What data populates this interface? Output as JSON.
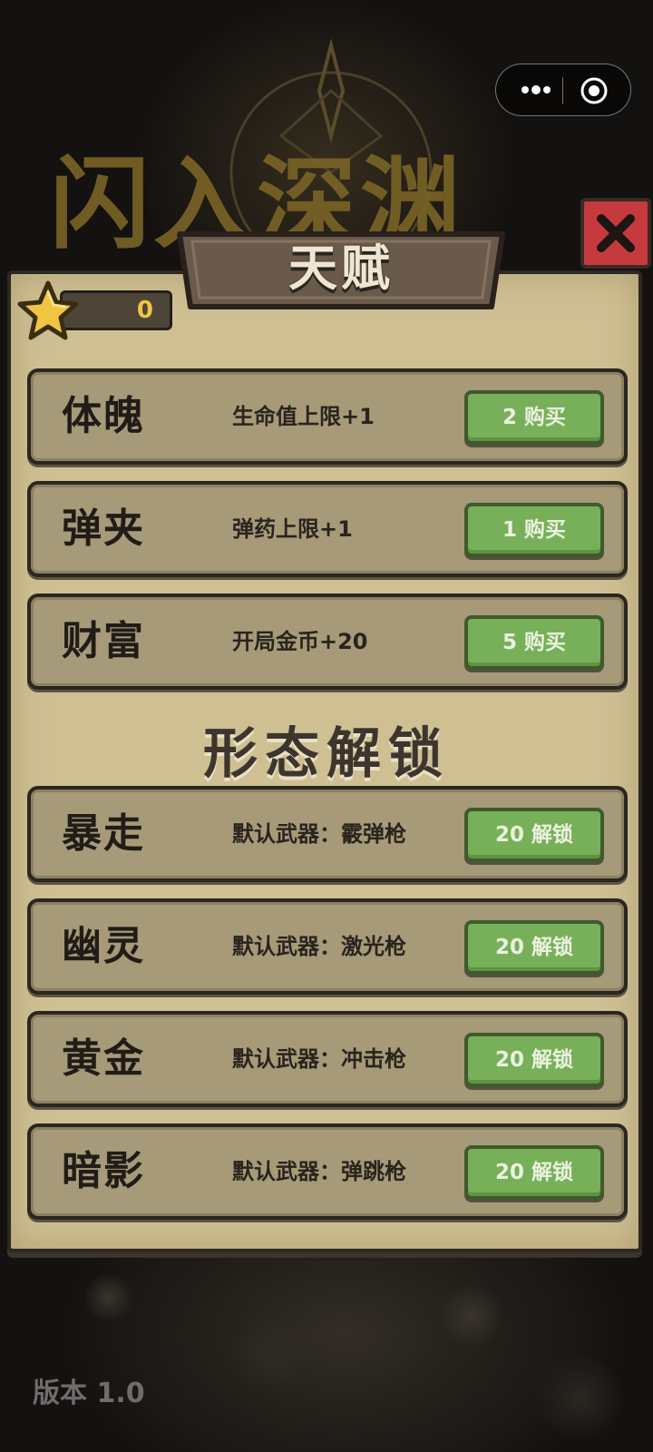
{
  "background_title": "闪入深渊",
  "capsule": {
    "more_icon": "more-dots-icon",
    "close_icon": "target-circle-icon"
  },
  "dialog": {
    "title": "天赋",
    "close_icon": "close-x-icon",
    "star_count": "0",
    "talents": [
      {
        "name": "体魄",
        "desc": "生命值上限+1",
        "button": "2 购买"
      },
      {
        "name": "弹夹",
        "desc": "弹药上限+1",
        "button": "1 购买"
      },
      {
        "name": "财富",
        "desc": "开局金币+20",
        "button": "5 购买"
      }
    ],
    "section_title": "形态解锁",
    "forms": [
      {
        "name": "暴走",
        "desc": "默认武器：霰弹枪",
        "button": "20 解锁"
      },
      {
        "name": "幽灵",
        "desc": "默认武器：激光枪",
        "button": "20 解锁"
      },
      {
        "name": "黄金",
        "desc": "默认武器：冲击枪",
        "button": "20 解锁"
      },
      {
        "name": "暗影",
        "desc": "默认武器：弹跳枪",
        "button": "20 解锁"
      }
    ]
  },
  "version": "版本 1.0",
  "colors": {
    "panel": "#cfc094",
    "row": "#a69a78",
    "button": "#78b05a",
    "close": "#c63a3d",
    "star": "#f1c544"
  }
}
